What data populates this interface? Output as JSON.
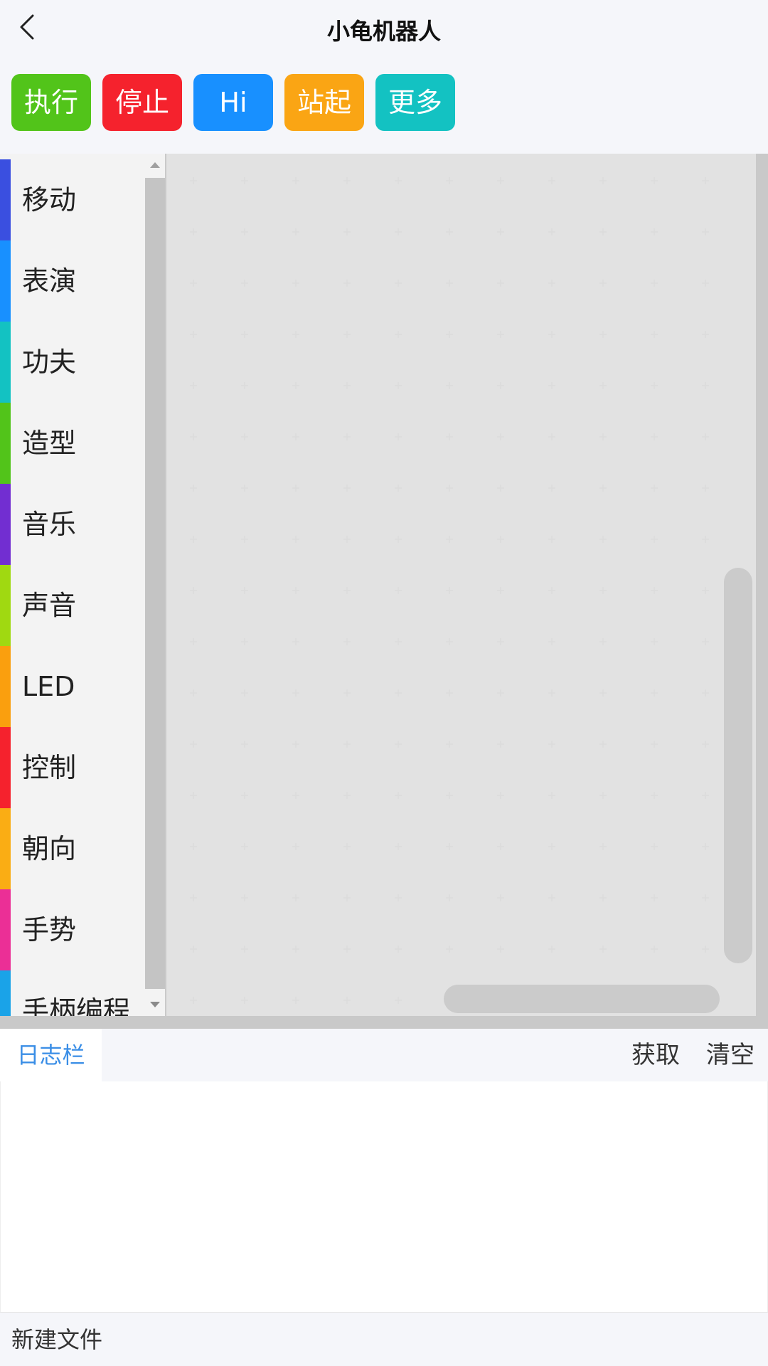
{
  "header": {
    "title": "小龟机器人",
    "back_icon": "chevron-left-icon"
  },
  "actions": [
    {
      "label": "执行",
      "color": "#52c41a"
    },
    {
      "label": "停止",
      "color": "#f5222d"
    },
    {
      "label": "Hi",
      "color": "#1890ff"
    },
    {
      "label": "站起",
      "color": "#faa514"
    },
    {
      "label": "更多",
      "color": "#13c2c2"
    }
  ],
  "toolbox": {
    "categories": [
      {
        "label": "移动",
        "color": "#3a4fe0"
      },
      {
        "label": "表演",
        "color": "#1890ff"
      },
      {
        "label": "功夫",
        "color": "#13c2c2"
      },
      {
        "label": "造型",
        "color": "#52c41a"
      },
      {
        "label": "音乐",
        "color": "#722ed1"
      },
      {
        "label": "声音",
        "color": "#a0d911"
      },
      {
        "label": "LED",
        "color": "#fa9f0e"
      },
      {
        "label": "控制",
        "color": "#f5222d"
      },
      {
        "label": "朝向",
        "color": "#faad14"
      },
      {
        "label": "手势",
        "color": "#eb2f96"
      },
      {
        "label": "手柄编程",
        "color": "#1aa3e8"
      }
    ]
  },
  "log": {
    "tab_label": "日志栏",
    "get_label": "获取",
    "clear_label": "清空"
  },
  "footer": {
    "new_file_label": "新建文件"
  }
}
